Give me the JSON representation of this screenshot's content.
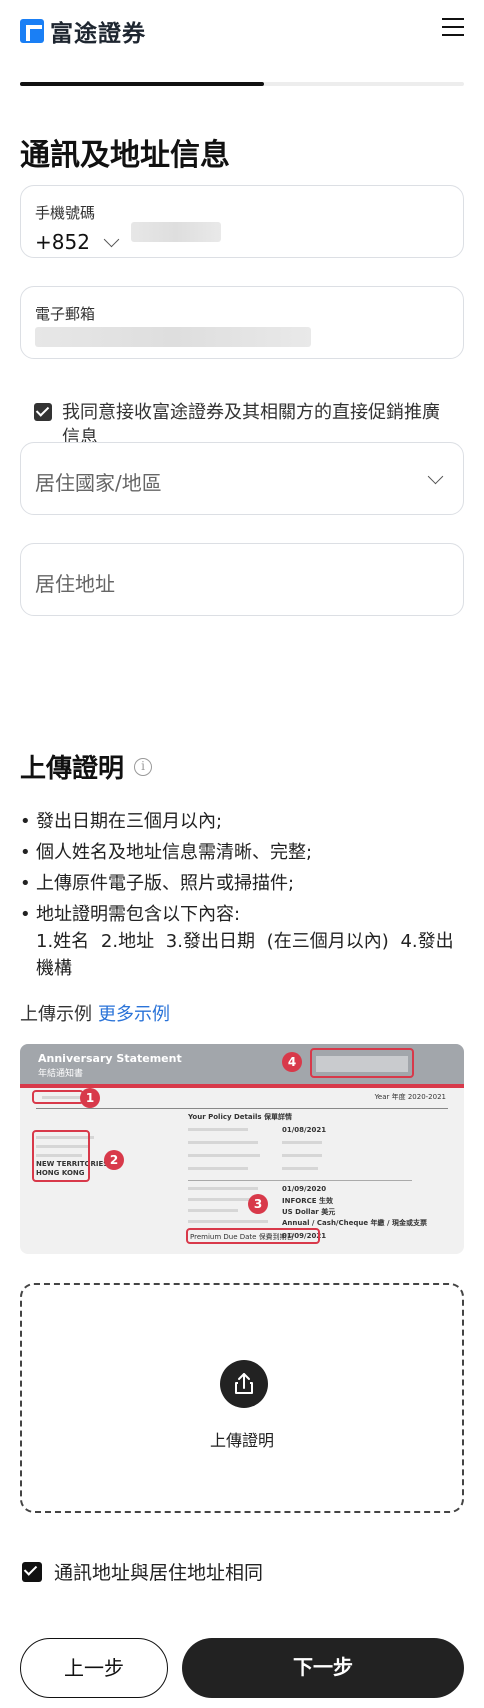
{
  "header": {
    "logo_text": "富途證券",
    "menu_icon": "hamburger-menu-icon"
  },
  "progress": {
    "fraction": 0.55
  },
  "page_title": "通訊及地址信息",
  "phone": {
    "label": "手機號碼",
    "country_code": "+852"
  },
  "email": {
    "label": "電子郵箱"
  },
  "consent": {
    "checked": true,
    "text": "我同意接收富途證券及其相關方的直接促銷推廣信息"
  },
  "residence_country": {
    "placeholder": "居住國家/地區"
  },
  "residence_address": {
    "placeholder": "居住地址"
  },
  "proof": {
    "title": "上傳證明",
    "info_icon": "i",
    "bullets": [
      "發出日期在三個月以內;",
      "個人姓名及地址信息需清晰、完整;",
      "上傳原件電子版、照片或掃描件;",
      "地址證明需包含以下內容:"
    ],
    "bullet_sub": "1.姓名 2.地址 3.發出日期 (在三個月以內) 4.發出機構",
    "example_label": "上傳示例",
    "more_examples": "更多示例",
    "sample": {
      "title": "Anniversary Statement",
      "subtitle": "年結通知書",
      "markers": [
        "1",
        "2",
        "3",
        "4"
      ],
      "year_text": "Year 年度 2020-2021",
      "details_heading": "Your Policy Details 保單詳情",
      "printed_date": "01/08/2021",
      "commencing_date": "01/09/2020",
      "policy_status": "INFORCE 生效",
      "currency": "US Dollar 美元",
      "payment_method": "Annual / Cash/Cheque 年繳 / 現金或支票",
      "premium_due_label": "Premium Due Date 保費到期日",
      "premium_due_date": "01/09/2021",
      "address_lines": [
        "NEW TERRITORIES",
        "HONG KONG"
      ]
    },
    "upload_label": "上傳證明",
    "upload_icon": "share-upload-icon"
  },
  "same_address": {
    "checked": true,
    "text": "通訊地址與居住地址相同"
  },
  "buttons": {
    "prev": "上一步",
    "next": "下一步"
  }
}
